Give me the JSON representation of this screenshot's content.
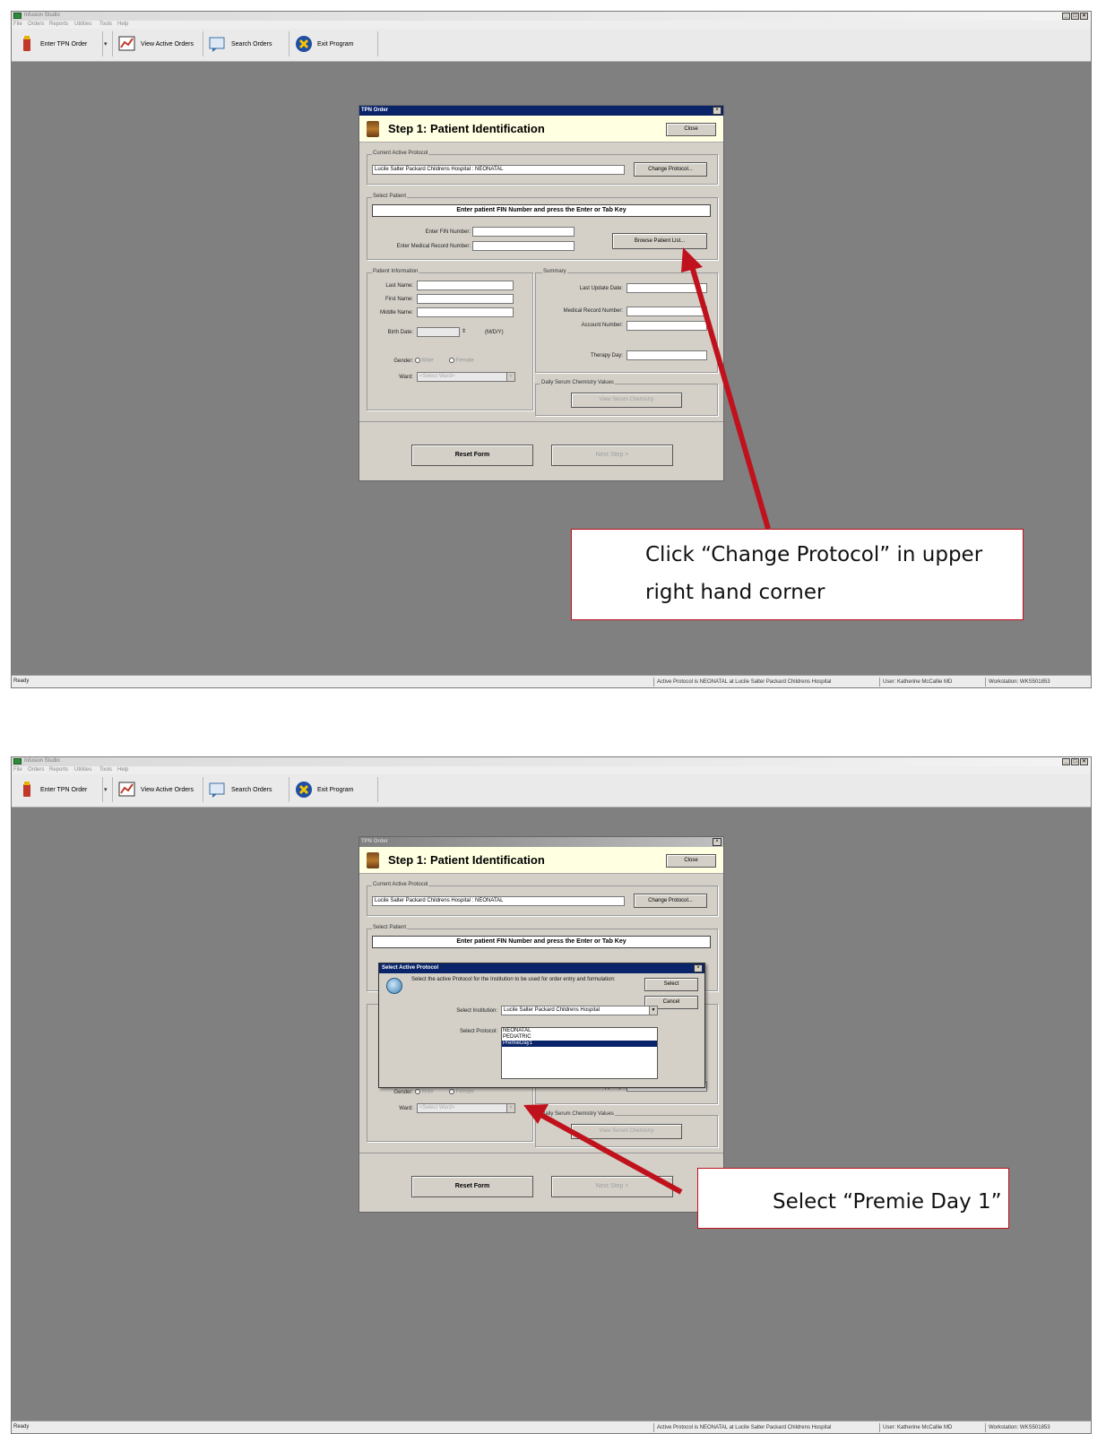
{
  "app": {
    "title": "Infusion Studio",
    "menu": [
      "File",
      "Orders",
      "Reports",
      "Utilities",
      "Tools",
      "Help"
    ],
    "toolbar": {
      "enter_tpn_order": "Enter TPN Order",
      "view_active_orders": "View Active Orders",
      "search_orders": "Search Orders",
      "exit_program": "Exit Program"
    },
    "window_controls": [
      "_",
      "□",
      "×"
    ],
    "status": {
      "ready": "Ready",
      "active_protocol": "Active Protocol is NEONATAL at Lucile Salter Packard Childrens Hospital",
      "user": "User: Katherine McCallie MD",
      "workstation": "Workstation: WKS501853"
    }
  },
  "dialog": {
    "title": "TPN Order",
    "step_title": "Step 1: Patient Identification",
    "close_label": "Close",
    "current_protocol_group": "Current Active Protocol",
    "current_protocol_value": "Lucile Salter Packard Childrens Hospital : NEONATAL",
    "change_protocol_label": "Change Protocol...",
    "select_patient_group": "Select Patient",
    "fin_banner": "Enter patient FIN Number and press the Enter or Tab Key",
    "enter_fin_label": "Enter FIN Number:",
    "enter_mrn_label": "Enter Medical Record Number:",
    "browse_patient_list_label": "Browse Patient List...",
    "patient_info_group": "Patient Information",
    "last_name_label": "Last Name:",
    "first_name_label": "First Name:",
    "middle_name_label": "Middle Name:",
    "birth_date_label": "Birth Date:",
    "birth_date_format": "(M/D/Y)",
    "gender_label": "Gender:",
    "gender_male": "Male",
    "gender_female": "Female",
    "ward_label": "Ward:",
    "ward_placeholder": "<Select Ward>",
    "summary_group": "Summary",
    "last_update_date_label": "Last Update Date:",
    "summary_mrn_label": "Medical Record Number:",
    "account_number_label": "Account Number:",
    "therapy_day_label": "Therapy Day:",
    "chemistry_group": "Daily Serum Chemistry Values",
    "chemistry_button": "View Serum Chemistry",
    "reset_form_label": "Reset Form",
    "next_step_label": "Next Step >"
  },
  "protocol_dialog": {
    "title": "Select Active Protocol",
    "description": "Select the active Protocol for the Institution to be used for order entry and formulation:",
    "select_label": "Select",
    "cancel_label": "Cancel",
    "institution_label": "Select Institution:",
    "institution_value": "Lucile Salter Packard Childrens Hospital",
    "protocol_label": "Select Protocol:",
    "protocols": [
      "NEONATAL",
      "PEDIATRIC",
      "PremieDay1"
    ],
    "selected_protocol": "PremieDay1"
  },
  "annotations": {
    "callout1_line1": "Click “Change Protocol” in upper",
    "callout1_line2": "right hand corner",
    "callout2": "Select “Premie Day 1”",
    "arrow_color": "#c0121d"
  },
  "colors": {
    "desktop": "#808080",
    "title_active": "#0a246a",
    "header_bg": "#ffffe1",
    "callout_border": "#c0121d"
  }
}
